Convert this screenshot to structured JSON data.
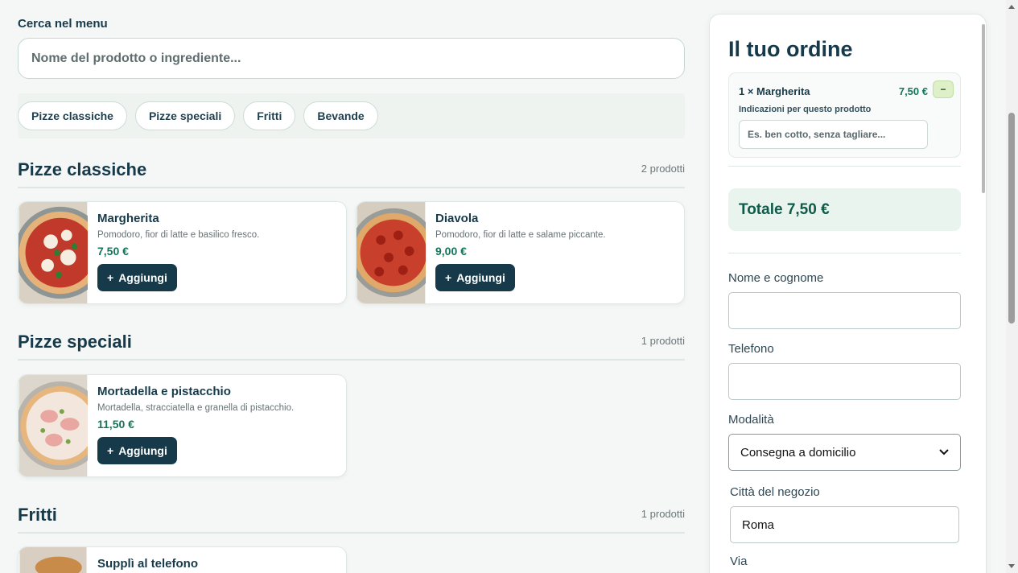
{
  "search": {
    "label": "Cerca nel menu",
    "placeholder": "Nome del prodotto o ingrediente..."
  },
  "chips": [
    "Pizze classiche",
    "Pizze speciali",
    "Fritti",
    "Bevande"
  ],
  "sections": [
    {
      "title": "Pizze classiche",
      "count": "2 prodotti",
      "items": [
        {
          "name": "Margherita",
          "desc": "Pomodoro, fior di latte e basilico fresco.",
          "price": "7,50 €",
          "button": "Aggiungi"
        },
        {
          "name": "Diavola",
          "desc": "Pomodoro, fior di latte e salame piccante.",
          "price": "9,00 €",
          "button": "Aggiungi"
        }
      ]
    },
    {
      "title": "Pizze speciali",
      "count": "1 prodotti",
      "items": [
        {
          "name": "Mortadella e pistacchio",
          "desc": "Mortadella, stracciatella e granella di pistacchio.",
          "price": "11,50 €",
          "button": "Aggiungi"
        }
      ]
    },
    {
      "title": "Fritti",
      "count": "1 prodotti",
      "items": [
        {
          "name": "Supplì al telefono"
        }
      ]
    }
  ],
  "order": {
    "title": "Il tuo ordine",
    "item": {
      "name": "1 × Margherita",
      "price": "7,50 €",
      "minus": "−",
      "notes_label": "Indicazioni per questo prodotto",
      "notes_placeholder": "Es. ben cotto, senza tagliare..."
    },
    "total": "Totale 7,50 €",
    "fields": {
      "name_label": "Nome e cognome",
      "phone_label": "Telefono",
      "mode_label": "Modalità",
      "mode_value": "Consegna a domicilio",
      "city_label": "Città del negozio",
      "city_value": "Roma",
      "street_label": "Via"
    }
  },
  "icons": {
    "plus": "+",
    "chevron": "chevron-down-icon"
  },
  "colors": {
    "primary": "#173a4a",
    "price": "#17745a",
    "total_bg": "#e9f4ee"
  }
}
